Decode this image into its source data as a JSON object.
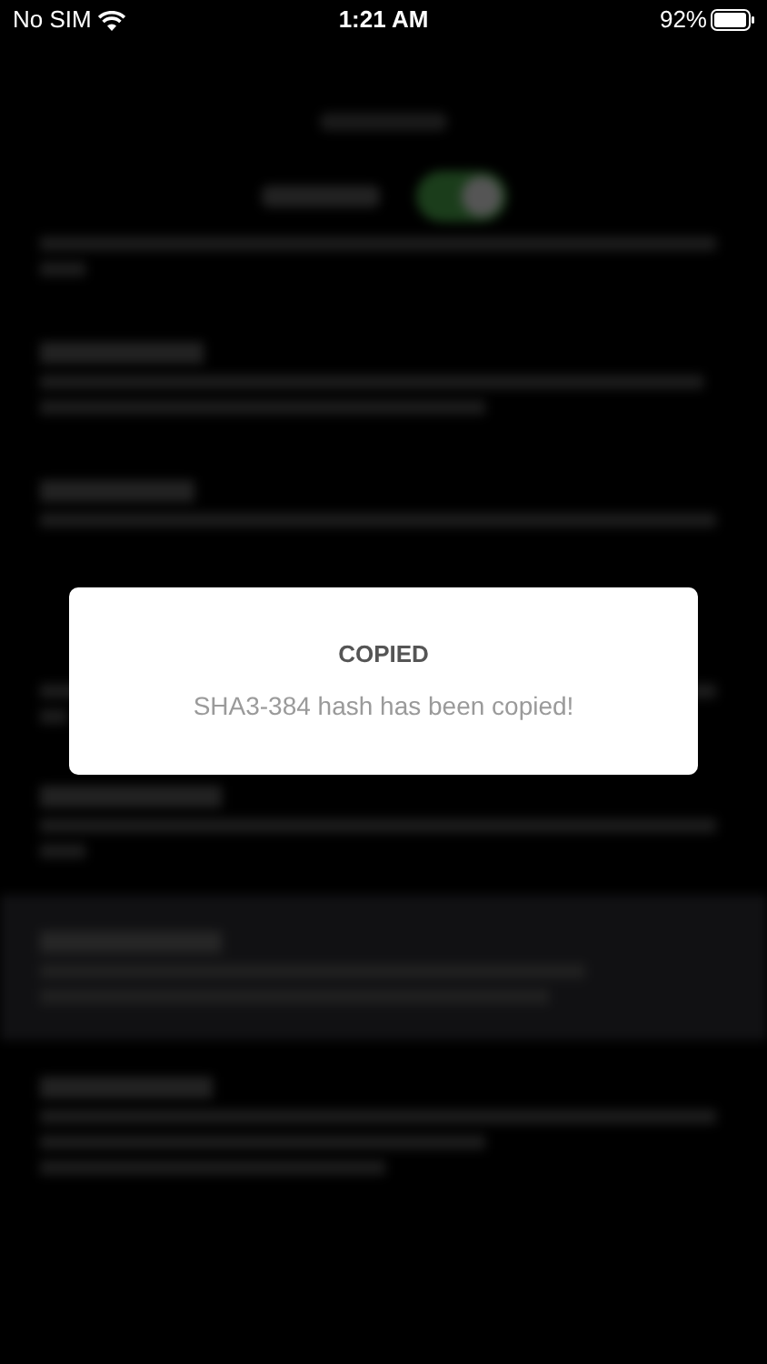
{
  "status_bar": {
    "carrier": "No SIM",
    "time": "1:21 AM",
    "battery": "92%"
  },
  "alert": {
    "title": "COPIED",
    "message": "SHA3-384 hash has been copied!"
  }
}
